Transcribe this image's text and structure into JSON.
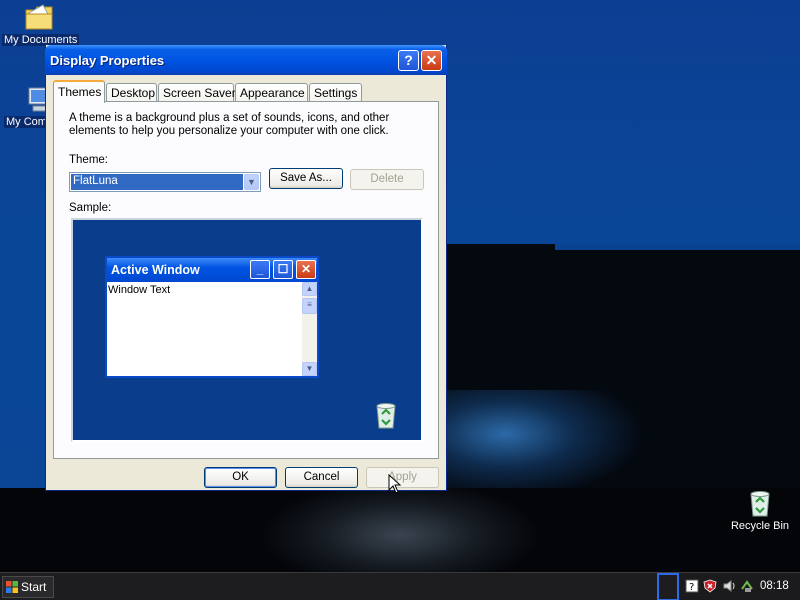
{
  "desktop": {
    "icons": [
      {
        "label": "My Documents"
      },
      {
        "label": "My Computer"
      },
      {
        "label": "Recycle Bin"
      }
    ]
  },
  "window": {
    "title": "Display Properties",
    "help_label": "?",
    "close_label": "✕",
    "tabs": [
      {
        "label": "Themes"
      },
      {
        "label": "Desktop"
      },
      {
        "label": "Screen Saver"
      },
      {
        "label": "Appearance"
      },
      {
        "label": "Settings"
      }
    ],
    "description": "A theme is a background plus a set of sounds, icons, and other elements to help you personalize your computer with one click.",
    "theme_label": "Theme:",
    "theme_value": "FlatLuna",
    "save_as_label": "Save As...",
    "delete_label": "Delete",
    "sample_label": "Sample:",
    "sample": {
      "title": "Active Window",
      "text": "Window Text"
    },
    "ok_label": "OK",
    "cancel_label": "Cancel",
    "apply_label": "Apply"
  },
  "taskbar": {
    "start_label": "Start",
    "clock": "08:18"
  }
}
